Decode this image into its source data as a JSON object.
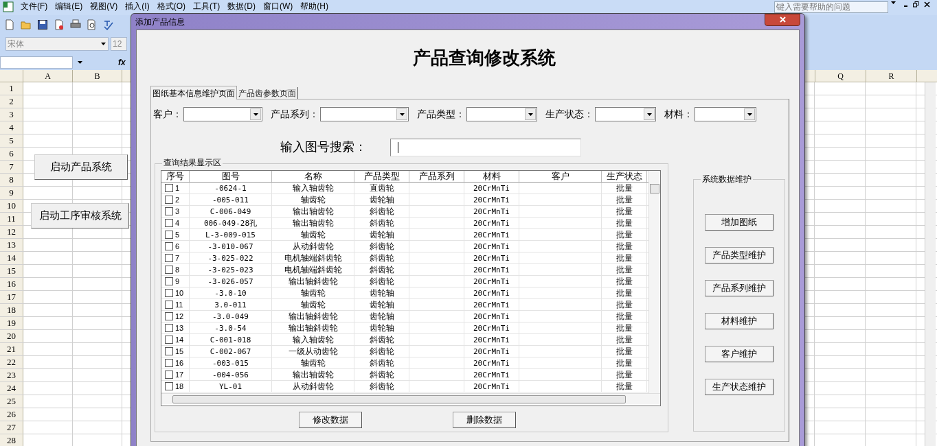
{
  "excel": {
    "menu": [
      "文件(F)",
      "编辑(E)",
      "视图(V)",
      "插入(I)",
      "格式(O)",
      "工具(T)",
      "数据(D)",
      "窗口(W)",
      "帮助(H)"
    ],
    "help_search": {
      "placeholder": "键入需要帮助的问题"
    },
    "font_name": "宋体",
    "font_size": "12",
    "fx_label": "fx",
    "columns_left": [
      "A",
      "B"
    ],
    "columns_right": [
      "Q",
      "R"
    ],
    "row_numbers": [
      "1",
      "2",
      "3",
      "4",
      "5",
      "6",
      "7",
      "8",
      "9",
      "10",
      "11",
      "12",
      "13",
      "14",
      "15",
      "16",
      "17",
      "18",
      "19",
      "20",
      "21",
      "22",
      "23",
      "24",
      "25",
      "26",
      "27",
      "28"
    ],
    "sheet_buttons": [
      "启动产品系统",
      "启动工序审核系统"
    ]
  },
  "dialog": {
    "title": "添加产品信息",
    "heading": "产品查询修改系统",
    "tabs": [
      {
        "label": "图纸基本信息维护页面",
        "selected": true
      },
      {
        "label": "产品齿参数页面",
        "selected": false
      }
    ],
    "filters": [
      {
        "label": "客户："
      },
      {
        "label": "产品系列："
      },
      {
        "label": "产品类型："
      },
      {
        "label": "生产状态："
      },
      {
        "label": "材料："
      }
    ],
    "search": {
      "label": "输入图号搜索："
    },
    "results": {
      "legend": "查询结果显示区",
      "columns": [
        "序号",
        "图号",
        "名称",
        "产品类型",
        "产品系列",
        "材料",
        "客户",
        "生产状态"
      ],
      "rows": [
        {
          "checked": false,
          "number": "1",
          "drawing_no": "-0624-1",
          "name": "输入轴齿轮",
          "type": "直齿轮",
          "material": "20CrMnTi",
          "status": "批量"
        },
        {
          "checked": false,
          "number": "2",
          "drawing_no": "-005-011",
          "name": "轴齿轮",
          "type": "齿轮轴",
          "material": "20CrMnTi",
          "status": "批量"
        },
        {
          "checked": false,
          "number": "3",
          "drawing_no": "C-006-049",
          "name": "输出轴齿轮",
          "type": "斜齿轮",
          "material": "20CrMnTi",
          "status": "批量"
        },
        {
          "checked": false,
          "number": "4",
          "drawing_no": "006-049-28孔",
          "name": "输出轴齿轮",
          "type": "斜齿轮",
          "material": "20CrMnTi",
          "status": "批量"
        },
        {
          "checked": false,
          "number": "5",
          "drawing_no": "L-3-009-015",
          "name": "轴齿轮",
          "type": "齿轮轴",
          "material": "20CrMnTi",
          "status": "批量"
        },
        {
          "checked": false,
          "number": "6",
          "drawing_no": "-3-010-067",
          "name": "从动斜齿轮",
          "type": "斜齿轮",
          "material": "20CrMnTi",
          "status": "批量"
        },
        {
          "checked": false,
          "number": "7",
          "drawing_no": "-3-025-022",
          "name": "电机轴端斜齿轮",
          "type": "斜齿轮",
          "material": "20CrMnTi",
          "status": "批量"
        },
        {
          "checked": false,
          "number": "8",
          "drawing_no": "-3-025-023",
          "name": "电机轴端斜齿轮",
          "type": "斜齿轮",
          "material": "20CrMnTi",
          "status": "批量"
        },
        {
          "checked": false,
          "number": "9",
          "drawing_no": "-3-026-057",
          "name": "输出轴斜齿轮",
          "type": "斜齿轮",
          "material": "20CrMnTi",
          "status": "批量"
        },
        {
          "checked": false,
          "number": "10",
          "drawing_no": "-3.0-10",
          "name": "轴齿轮",
          "type": "齿轮轴",
          "material": "20CrMnTi",
          "status": "批量"
        },
        {
          "checked": false,
          "number": "11",
          "drawing_no": "3.0-011",
          "name": "轴齿轮",
          "type": "齿轮轴",
          "material": "20CrMnTi",
          "status": "批量"
        },
        {
          "checked": false,
          "number": "12",
          "drawing_no": "-3.0-049",
          "name": "输出轴斜齿轮",
          "type": "齿轮轴",
          "material": "20CrMnTi",
          "status": "批量"
        },
        {
          "checked": false,
          "number": "13",
          "drawing_no": "-3.0-54",
          "name": "输出轴斜齿轮",
          "type": "齿轮轴",
          "material": "20CrMnTi",
          "status": "批量"
        },
        {
          "checked": false,
          "number": "14",
          "drawing_no": "C-001-018",
          "name": "输入轴齿轮",
          "type": "斜齿轮",
          "material": "20CrMnTi",
          "status": "批量"
        },
        {
          "checked": false,
          "number": "15",
          "drawing_no": "C-002-067",
          "name": "一级从动齿轮",
          "type": "斜齿轮",
          "material": "20CrMnTi",
          "status": "批量"
        },
        {
          "checked": false,
          "number": "16",
          "drawing_no": "-003-015",
          "name": "轴齿轮",
          "type": "斜齿轮",
          "material": "20CrMnTi",
          "status": "批量"
        },
        {
          "checked": false,
          "number": "17",
          "drawing_no": "-004-056",
          "name": "输出轴齿轮",
          "type": "斜齿轮",
          "material": "20CrMnTi",
          "status": "批量"
        },
        {
          "checked": false,
          "number": "18",
          "drawing_no": "YL-01",
          "name": "从动斜齿轮",
          "type": "斜齿轮",
          "material": "20CrMnTi",
          "status": "批量"
        }
      ]
    },
    "actions": [
      "修改数据",
      "删除数据"
    ],
    "maintenance": {
      "legend": "系统数据维护",
      "buttons": [
        "增加图纸",
        "产品类型维护",
        "产品系列维护",
        "材料维护",
        "客户维护",
        "生产状态维护"
      ]
    }
  }
}
